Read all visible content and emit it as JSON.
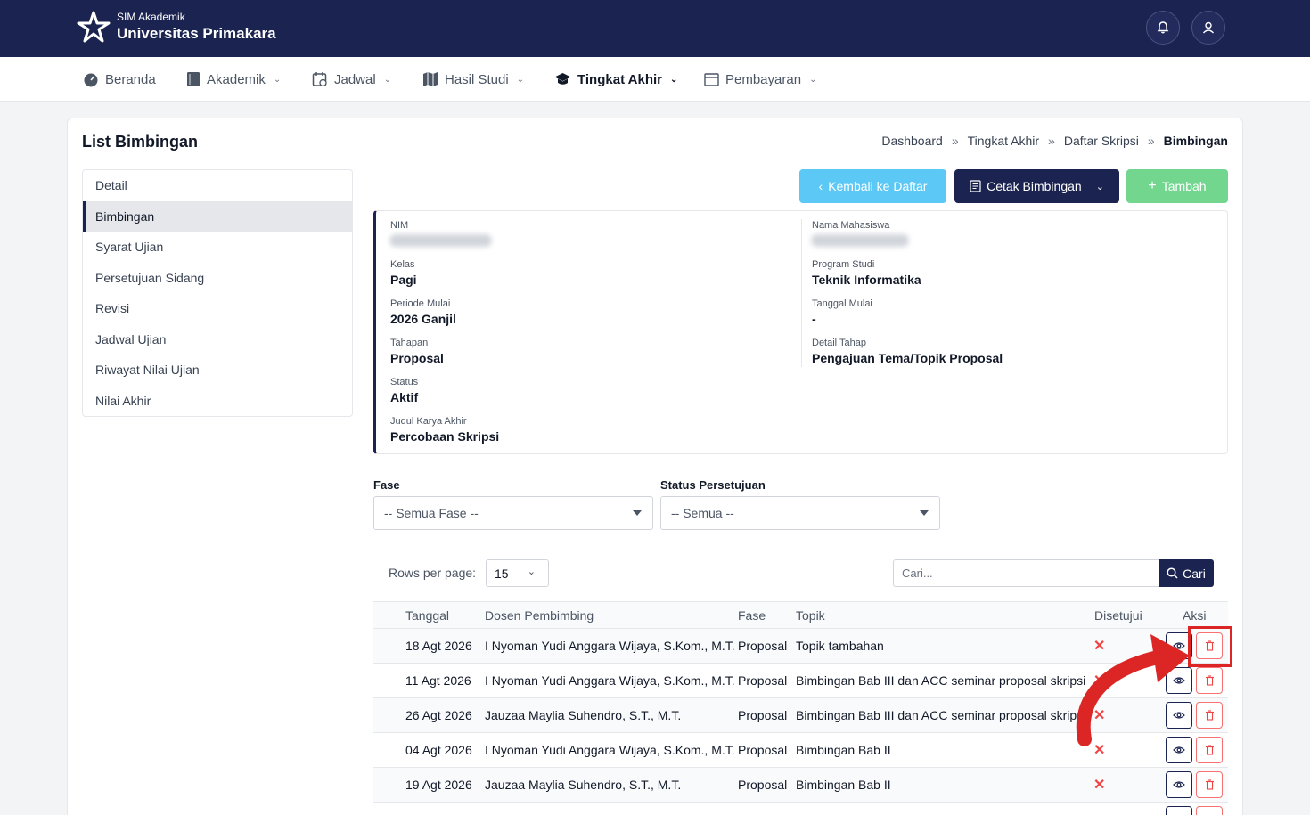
{
  "header": {
    "brand_sub": "SIM Akademik",
    "brand_main": "Universitas Primakara",
    "bell_icon": "bell-icon",
    "user_icon": "user-icon"
  },
  "nav": {
    "items": [
      {
        "label": "Beranda",
        "icon": "dashboard-icon"
      },
      {
        "label": "Akademik",
        "icon": "book-icon"
      },
      {
        "label": "Jadwal",
        "icon": "calendar-icon"
      },
      {
        "label": "Hasil Studi",
        "icon": "map-icon"
      },
      {
        "label": "Tingkat Akhir",
        "icon": "graduation-cap-icon"
      },
      {
        "label": "Pembayaran",
        "icon": "wallet-icon"
      }
    ]
  },
  "page": {
    "title": "List Bimbingan",
    "breadcrumb": [
      "Dashboard",
      "Tingkat Akhir",
      "Daftar Skripsi",
      "Bimbingan"
    ]
  },
  "sidemenu": {
    "items": [
      "Detail",
      "Bimbingan",
      "Syarat Ujian",
      "Persetujuan Sidang",
      "Revisi",
      "Jadwal Ujian",
      "Riwayat Nilai Ujian",
      "Nilai Akhir"
    ]
  },
  "actions": {
    "back": "Kembali ke Daftar",
    "print": "Cetak Bimbingan",
    "add": "Tambah"
  },
  "info": {
    "nim_label": "NIM",
    "nama_label": "Nama Mahasiswa",
    "kelas_label": "Kelas",
    "kelas": "Pagi",
    "prodi_label": "Program Studi",
    "prodi": "Teknik Informatika",
    "periode_label": "Periode Mulai",
    "periode": "2026 Ganjil",
    "tanggal_label": "Tanggal Mulai",
    "tanggal": "-",
    "tahapan_label": "Tahapan",
    "tahapan": "Proposal",
    "detail_label": "Detail Tahap",
    "detail": "Pengajuan Tema/Topik Proposal",
    "status_label": "Status",
    "status": "Aktif",
    "judul_label": "Judul Karya Akhir",
    "judul": "Percobaan Skripsi"
  },
  "filters": {
    "fase_label": "Fase",
    "fase_value": "-- Semua Fase --",
    "status_label": "Status Persetujuan",
    "status_value": "-- Semua --"
  },
  "table_controls": {
    "rows_label": "Rows per page:",
    "rows_value": "15",
    "search_placeholder": "Cari...",
    "search_button": "Cari"
  },
  "table": {
    "headers": [
      "Tanggal",
      "Dosen Pembimbing",
      "Fase",
      "Topik",
      "Disetujui",
      "Aksi"
    ],
    "rows": [
      {
        "tanggal": "18 Agt 2026",
        "dosen": "I Nyoman Yudi Anggara Wijaya, S.Kom., M.T.",
        "fase": "Proposal",
        "topik": "Topik tambahan"
      },
      {
        "tanggal": "11 Agt 2026",
        "dosen": "I Nyoman Yudi Anggara Wijaya, S.Kom., M.T.",
        "fase": "Proposal",
        "topik": "Bimbingan Bab III dan ACC seminar proposal skripsi"
      },
      {
        "tanggal": "26 Agt 2026",
        "dosen": "Jauzaa Maylia Suhendro, S.T., M.T.",
        "fase": "Proposal",
        "topik": "Bimbingan Bab III dan ACC seminar proposal skripsi"
      },
      {
        "tanggal": "04 Agt 2026",
        "dosen": "I Nyoman Yudi Anggara Wijaya, S.Kom., M.T.",
        "fase": "Proposal",
        "topik": "Bimbingan Bab II"
      },
      {
        "tanggal": "19 Agt 2026",
        "dosen": "Jauzaa Maylia Suhendro, S.T., M.T.",
        "fase": "Proposal",
        "topik": "Bimbingan Bab II"
      }
    ]
  },
  "colors": {
    "navy": "#1b2350",
    "back_btn": "#5bc8f5",
    "add_btn": "#72d68f",
    "danger": "#ef4444",
    "annotation": "#dc2626"
  }
}
